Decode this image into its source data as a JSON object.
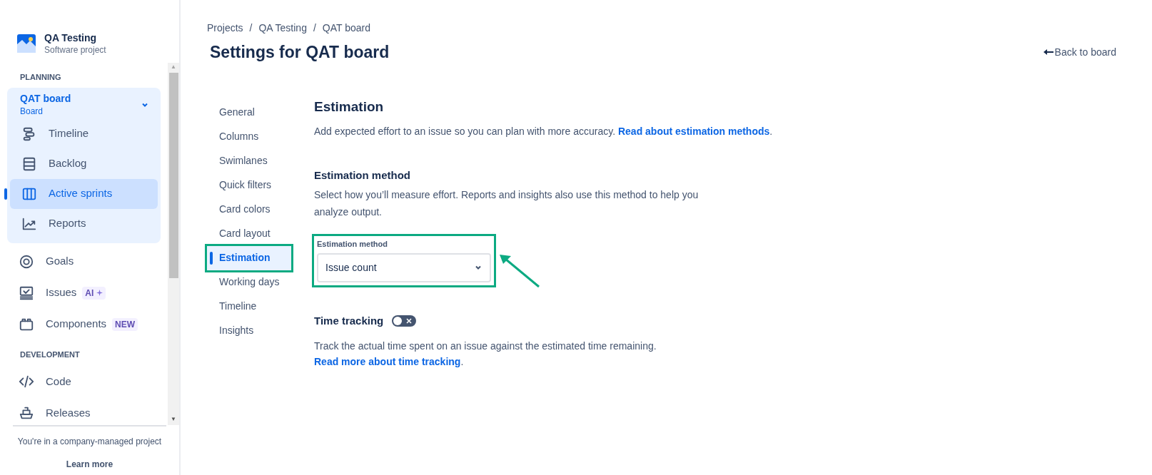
{
  "project": {
    "name": "QA Testing",
    "type": "Software project"
  },
  "sidebar": {
    "sections": [
      {
        "heading": "PLANNING",
        "items": [
          {
            "kind": "group",
            "label": "QAT board",
            "sublabel": "Board",
            "expanded": true,
            "children": [
              {
                "label": "Timeline",
                "selected": false
              },
              {
                "label": "Backlog",
                "selected": false
              },
              {
                "label": "Active sprints",
                "selected": true
              },
              {
                "label": "Reports",
                "selected": false
              }
            ]
          },
          {
            "kind": "item",
            "label": "Goals",
            "selected": false
          },
          {
            "kind": "item",
            "label": "Issues",
            "selected": false,
            "badge": "AI",
            "badge_sparkle": true
          },
          {
            "kind": "item",
            "label": "Components",
            "selected": false,
            "badge": "NEW",
            "badge_sparkle": false
          }
        ]
      },
      {
        "heading": "DEVELOPMENT",
        "items": [
          {
            "kind": "item",
            "label": "Code",
            "selected": false
          },
          {
            "kind": "item",
            "label": "Releases",
            "selected": false
          }
        ]
      }
    ],
    "scroll_arrows": [
      "▲",
      "▼"
    ],
    "footer": {
      "text": "You're in a company-managed project",
      "link": "Learn more"
    }
  },
  "breadcrumbs": [
    {
      "kind": "link",
      "text": "Projects"
    },
    {
      "kind": "separator",
      "text": "/"
    },
    {
      "kind": "link",
      "text": "QA Testing"
    },
    {
      "kind": "separator",
      "text": "/"
    },
    {
      "kind": "link",
      "text": "QAT board"
    }
  ],
  "page_title": "Settings for QAT board",
  "back_link": "Back to board",
  "settings_nav": [
    {
      "label": "General",
      "selected": false,
      "highlighted": false
    },
    {
      "label": "Columns",
      "selected": false,
      "highlighted": false
    },
    {
      "label": "Swimlanes",
      "selected": false,
      "highlighted": false
    },
    {
      "label": "Quick filters",
      "selected": false,
      "highlighted": false
    },
    {
      "label": "Card colors",
      "selected": false,
      "highlighted": false
    },
    {
      "label": "Card layout",
      "selected": false,
      "highlighted": false
    },
    {
      "label": "Estimation",
      "selected": true,
      "highlighted": true
    },
    {
      "label": "Working days",
      "selected": false,
      "highlighted": false
    },
    {
      "label": "Timeline",
      "selected": false,
      "highlighted": false
    },
    {
      "label": "Insights",
      "selected": false,
      "highlighted": false
    }
  ],
  "content": {
    "title": "Estimation",
    "description": "Add expected effort to an issue so you can plan with more accuracy.",
    "description_link": "Read about estimation methods",
    "description_end": ".",
    "method": {
      "heading": "Estimation method",
      "description": "Select how you’ll measure effort. Reports and insights also use this method to help you analyze output.",
      "field_label": "Estimation method",
      "value": "Issue count",
      "highlighted": true
    },
    "time_tracking": {
      "heading": "Time tracking",
      "on": false,
      "description": "Track the actual time spent on an issue against the estimated time remaining.",
      "link": "Read more about time tracking",
      "link_end": "."
    }
  }
}
